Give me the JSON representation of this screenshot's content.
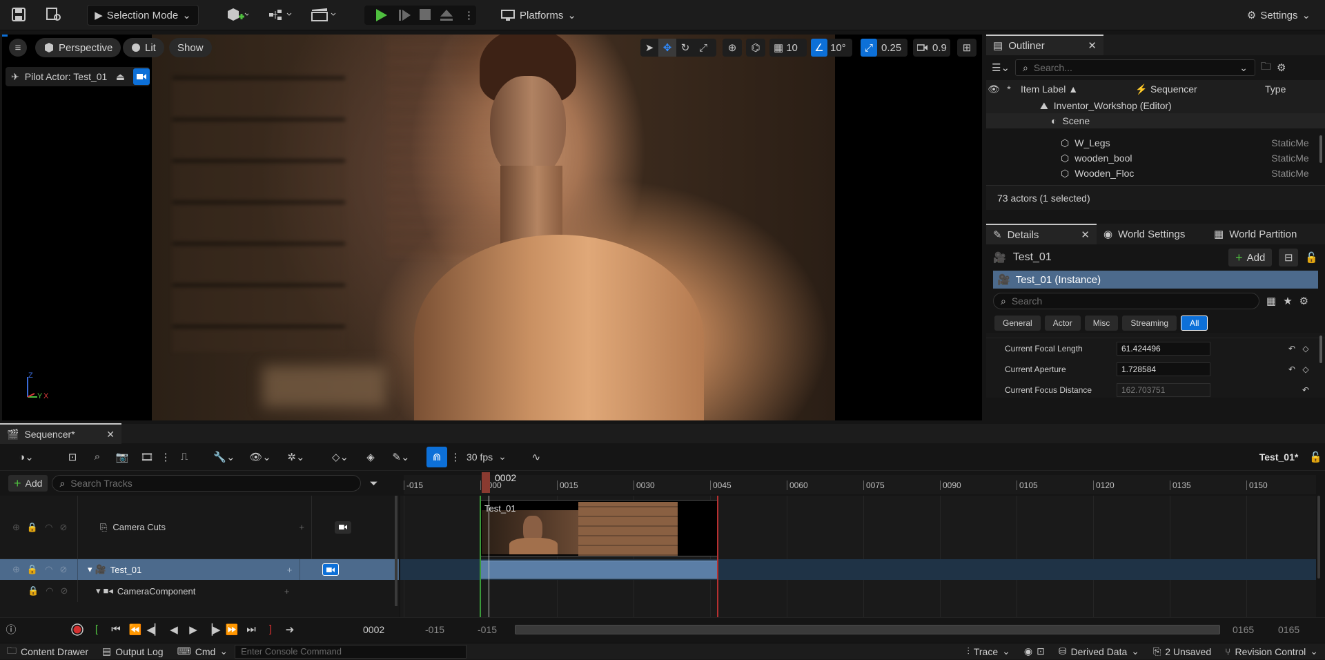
{
  "toolbar": {
    "selection_mode": "Selection Mode",
    "platforms": "Platforms",
    "settings": "Settings"
  },
  "viewport": {
    "perspective": "Perspective",
    "lit": "Lit",
    "show": "Show",
    "pilot_actor": "Pilot Actor: Test_01",
    "grid_snap": "10",
    "rotation_snap": "10°",
    "scale_snap": "0.25",
    "camera_speed": "0.9",
    "axis_z": "Z",
    "axis_y": "Y",
    "axis_x": "X"
  },
  "outliner": {
    "tab": "Outliner",
    "search_placeholder": "Search...",
    "columns": [
      "Item Label",
      "Sequencer",
      "Type"
    ],
    "rows": [
      {
        "label": "Inventor_Workshop (Editor)",
        "type": "",
        "indent": 0
      },
      {
        "label": "Scene",
        "type": "",
        "indent": 1
      },
      {
        "label": "W_Legs",
        "type": "StaticMe",
        "indent": 2
      },
      {
        "label": "wooden_bool",
        "type": "StaticMe",
        "indent": 2
      },
      {
        "label": "Wooden_Floc",
        "type": "StaticMe",
        "indent": 2
      }
    ],
    "status": "73 actors (1 selected)"
  },
  "details": {
    "tabs": [
      "Details",
      "World Settings",
      "World Partition"
    ],
    "actor_name": "Test_01",
    "add_label": "Add",
    "instance": "Test_01 (Instance)",
    "search_placeholder": "Search",
    "filters": [
      "General",
      "Actor",
      "Misc",
      "Streaming",
      "All"
    ],
    "properties": [
      {
        "name": "Current Focal Length",
        "value": "61.424496"
      },
      {
        "name": "Current Aperture",
        "value": "1.728584"
      },
      {
        "name": "Current Focus Distance",
        "value": "162.703751"
      }
    ]
  },
  "sequencer": {
    "tab": "Sequencer*",
    "fps": "30 fps",
    "sequence_name": "Test_01*",
    "add_label": "Add",
    "search_placeholder": "Search Tracks",
    "playhead_frame": "0002",
    "ruler_ticks": [
      "-015",
      "0000",
      "0015",
      "0030",
      "0045",
      "0060",
      "0075",
      "0090",
      "0105",
      "0120",
      "0135",
      "0150"
    ],
    "tracks": [
      {
        "label": "Camera Cuts"
      },
      {
        "label": "Test_01"
      },
      {
        "label": "CameraComponent"
      }
    ],
    "shot_label": "Test_01",
    "current_frame": "0002",
    "range_start": "-015",
    "range_start2": "-015",
    "range_end": "0165",
    "range_end2": "0165"
  },
  "statusbar": {
    "content_drawer": "Content Drawer",
    "output_log": "Output Log",
    "cmd": "Cmd",
    "console_placeholder": "Enter Console Command",
    "trace": "Trace",
    "derived_data": "Derived Data",
    "unsaved": "2 Unsaved",
    "revision_control": "Revision Control"
  },
  "colors": {
    "accent": "#0d70d8",
    "play_green": "#4fbf3f",
    "selected_row": "#4c6a8c",
    "record_red": "#d43030"
  }
}
